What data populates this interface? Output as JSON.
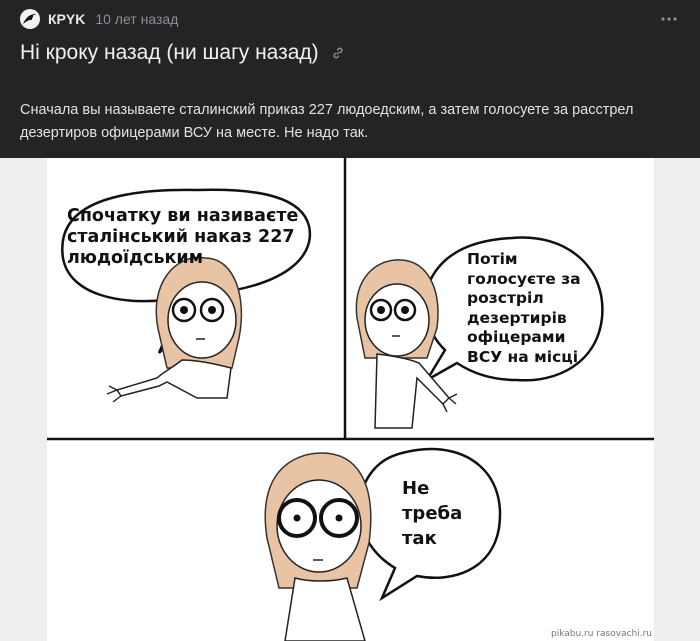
{
  "post": {
    "author": "КРYK",
    "time": "10 лет назад",
    "title": "Ні кроку назад (ни шагу назад)",
    "text": "Сначала вы называете сталинский приказ 227 людоедским, а затем голосуете за расстрел дезертиров офицерами ВСУ на месте. Не надо так."
  },
  "comic": {
    "panel1_text": "Спочатку ви називаєте\nсталінський наказ 227\nлюдоїдським",
    "panel2_text": "Потім\nголосуєте за\nрозстріл\nдезертирів\nофіцерами\nВСУ на місці",
    "panel3_text": "Не\nтреба\nтак",
    "watermark": "pikabu.ru\nrasovachi.ru"
  },
  "icons": {
    "avatar": "bird-avatar-icon",
    "more": "more-dots-icon",
    "link": "link-icon"
  },
  "colors": {
    "background": "#222426",
    "hair": "#e8c4a5",
    "muted": "#8d8f92"
  }
}
